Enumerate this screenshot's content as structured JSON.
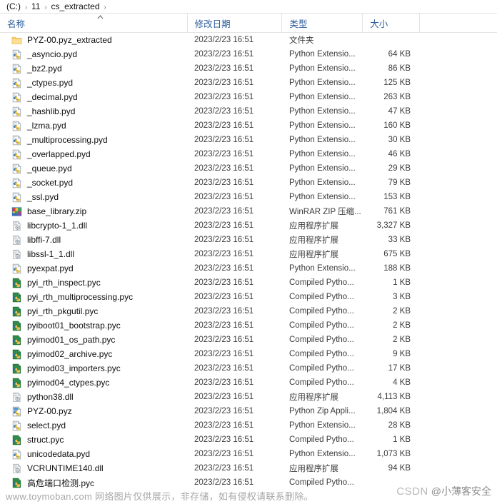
{
  "breadcrumb": {
    "items": [
      "(C:)",
      "11",
      "cs_extracted"
    ],
    "separator": "›"
  },
  "columns": {
    "name": "名称",
    "date": "修改日期",
    "type": "类型",
    "size": "大小",
    "sort_caret": "ⱏ"
  },
  "colors": {
    "header_text": "#2c5d9b",
    "row_text": "#0e0e0e",
    "meta_text": "#3c3c3c",
    "folder": "#ffd277",
    "divider": "#e4e4e4"
  },
  "files": [
    {
      "name": "PYZ-00.pyz_extracted",
      "date": "2023/2/23 16:51",
      "type": "文件夹",
      "size": "",
      "icon": "folder-icon"
    },
    {
      "name": "_asyncio.pyd",
      "date": "2023/2/23 16:51",
      "type": "Python Extensio...",
      "size": "64 KB",
      "icon": "pyd-icon"
    },
    {
      "name": "_bz2.pyd",
      "date": "2023/2/23 16:51",
      "type": "Python Extensio...",
      "size": "86 KB",
      "icon": "pyd-icon"
    },
    {
      "name": "_ctypes.pyd",
      "date": "2023/2/23 16:51",
      "type": "Python Extensio...",
      "size": "125 KB",
      "icon": "pyd-icon"
    },
    {
      "name": "_decimal.pyd",
      "date": "2023/2/23 16:51",
      "type": "Python Extensio...",
      "size": "263 KB",
      "icon": "pyd-icon"
    },
    {
      "name": "_hashlib.pyd",
      "date": "2023/2/23 16:51",
      "type": "Python Extensio...",
      "size": "47 KB",
      "icon": "pyd-icon"
    },
    {
      "name": "_lzma.pyd",
      "date": "2023/2/23 16:51",
      "type": "Python Extensio...",
      "size": "160 KB",
      "icon": "pyd-icon"
    },
    {
      "name": "_multiprocessing.pyd",
      "date": "2023/2/23 16:51",
      "type": "Python Extensio...",
      "size": "30 KB",
      "icon": "pyd-icon"
    },
    {
      "name": "_overlapped.pyd",
      "date": "2023/2/23 16:51",
      "type": "Python Extensio...",
      "size": "46 KB",
      "icon": "pyd-icon"
    },
    {
      "name": "_queue.pyd",
      "date": "2023/2/23 16:51",
      "type": "Python Extensio...",
      "size": "29 KB",
      "icon": "pyd-icon"
    },
    {
      "name": "_socket.pyd",
      "date": "2023/2/23 16:51",
      "type": "Python Extensio...",
      "size": "79 KB",
      "icon": "pyd-icon"
    },
    {
      "name": "_ssl.pyd",
      "date": "2023/2/23 16:51",
      "type": "Python Extensio...",
      "size": "153 KB",
      "icon": "pyd-icon"
    },
    {
      "name": "base_library.zip",
      "date": "2023/2/23 16:51",
      "type": "WinRAR ZIP 压缩...",
      "size": "761 KB",
      "icon": "winrar-zip-icon"
    },
    {
      "name": "libcrypto-1_1.dll",
      "date": "2023/2/23 16:51",
      "type": "应用程序扩展",
      "size": "3,327 KB",
      "icon": "dll-icon"
    },
    {
      "name": "libffi-7.dll",
      "date": "2023/2/23 16:51",
      "type": "应用程序扩展",
      "size": "33 KB",
      "icon": "dll-icon"
    },
    {
      "name": "libssl-1_1.dll",
      "date": "2023/2/23 16:51",
      "type": "应用程序扩展",
      "size": "675 KB",
      "icon": "dll-icon"
    },
    {
      "name": "pyexpat.pyd",
      "date": "2023/2/23 16:51",
      "type": "Python Extensio...",
      "size": "188 KB",
      "icon": "pyd-icon"
    },
    {
      "name": "pyi_rth_inspect.pyc",
      "date": "2023/2/23 16:51",
      "type": "Compiled Pytho...",
      "size": "1 KB",
      "icon": "pyc-icon"
    },
    {
      "name": "pyi_rth_multiprocessing.pyc",
      "date": "2023/2/23 16:51",
      "type": "Compiled Pytho...",
      "size": "3 KB",
      "icon": "pyc-icon"
    },
    {
      "name": "pyi_rth_pkgutil.pyc",
      "date": "2023/2/23 16:51",
      "type": "Compiled Pytho...",
      "size": "2 KB",
      "icon": "pyc-icon"
    },
    {
      "name": "pyiboot01_bootstrap.pyc",
      "date": "2023/2/23 16:51",
      "type": "Compiled Pytho...",
      "size": "2 KB",
      "icon": "pyc-icon"
    },
    {
      "name": "pyimod01_os_path.pyc",
      "date": "2023/2/23 16:51",
      "type": "Compiled Pytho...",
      "size": "2 KB",
      "icon": "pyc-icon"
    },
    {
      "name": "pyimod02_archive.pyc",
      "date": "2023/2/23 16:51",
      "type": "Compiled Pytho...",
      "size": "9 KB",
      "icon": "pyc-icon"
    },
    {
      "name": "pyimod03_importers.pyc",
      "date": "2023/2/23 16:51",
      "type": "Compiled Pytho...",
      "size": "17 KB",
      "icon": "pyc-icon"
    },
    {
      "name": "pyimod04_ctypes.pyc",
      "date": "2023/2/23 16:51",
      "type": "Compiled Pytho...",
      "size": "4 KB",
      "icon": "pyc-icon"
    },
    {
      "name": "python38.dll",
      "date": "2023/2/23 16:51",
      "type": "应用程序扩展",
      "size": "4,113 KB",
      "icon": "dll-icon"
    },
    {
      "name": "PYZ-00.pyz",
      "date": "2023/2/23 16:51",
      "type": "Python Zip Appli...",
      "size": "1,804 KB",
      "icon": "pyz-icon"
    },
    {
      "name": "select.pyd",
      "date": "2023/2/23 16:51",
      "type": "Python Extensio...",
      "size": "28 KB",
      "icon": "pyd-icon"
    },
    {
      "name": "struct.pyc",
      "date": "2023/2/23 16:51",
      "type": "Compiled Pytho...",
      "size": "1 KB",
      "icon": "pyc-icon"
    },
    {
      "name": "unicodedata.pyd",
      "date": "2023/2/23 16:51",
      "type": "Python Extensio...",
      "size": "1,073 KB",
      "icon": "pyd-icon"
    },
    {
      "name": "VCRUNTIME140.dll",
      "date": "2023/2/23 16:51",
      "type": "应用程序扩展",
      "size": "94 KB",
      "icon": "dll-icon"
    },
    {
      "name": "高危端口检测.pyc",
      "date": "2023/2/23 16:51",
      "type": "Compiled Pytho...",
      "size": "",
      "icon": "pyc-icon"
    }
  ],
  "watermarks": {
    "toymoban": "www.toymoban.com 网络图片仅供展示，非存储，如有侵权请联系删除。",
    "csdn_mark": "CSDN",
    "csdn_user": "@小薄客安全"
  }
}
